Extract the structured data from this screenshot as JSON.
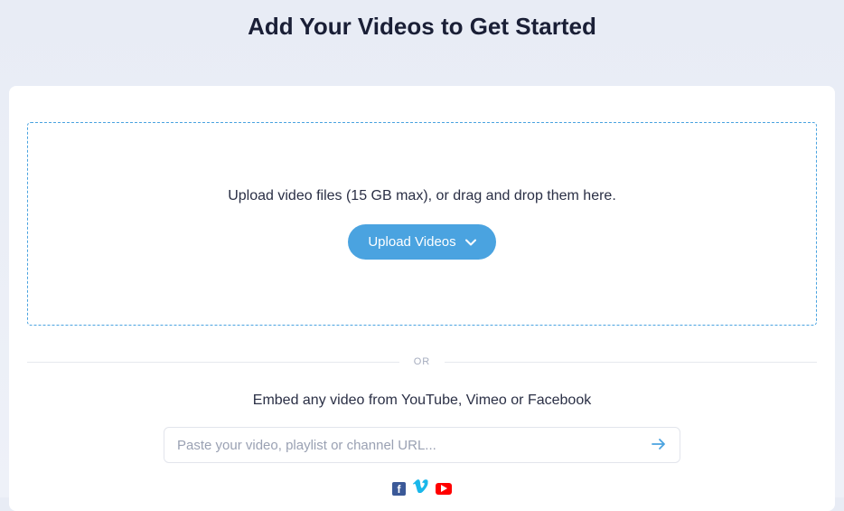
{
  "header": {
    "title": "Add Your Videos to Get Started"
  },
  "upload": {
    "dropzone_text": "Upload video files (15 GB max), or drag and drop them here.",
    "button_label": "Upload Videos"
  },
  "divider": {
    "label": "OR"
  },
  "embed": {
    "prompt": "Embed any video from YouTube, Vimeo or Facebook",
    "placeholder": "Paste your video, playlist or channel URL...",
    "providers": [
      "facebook",
      "vimeo",
      "youtube"
    ]
  },
  "colors": {
    "primary": "#4aa3e0",
    "facebook": "#3b5998",
    "vimeo": "#1ab7ea",
    "youtube": "#ff0000"
  }
}
